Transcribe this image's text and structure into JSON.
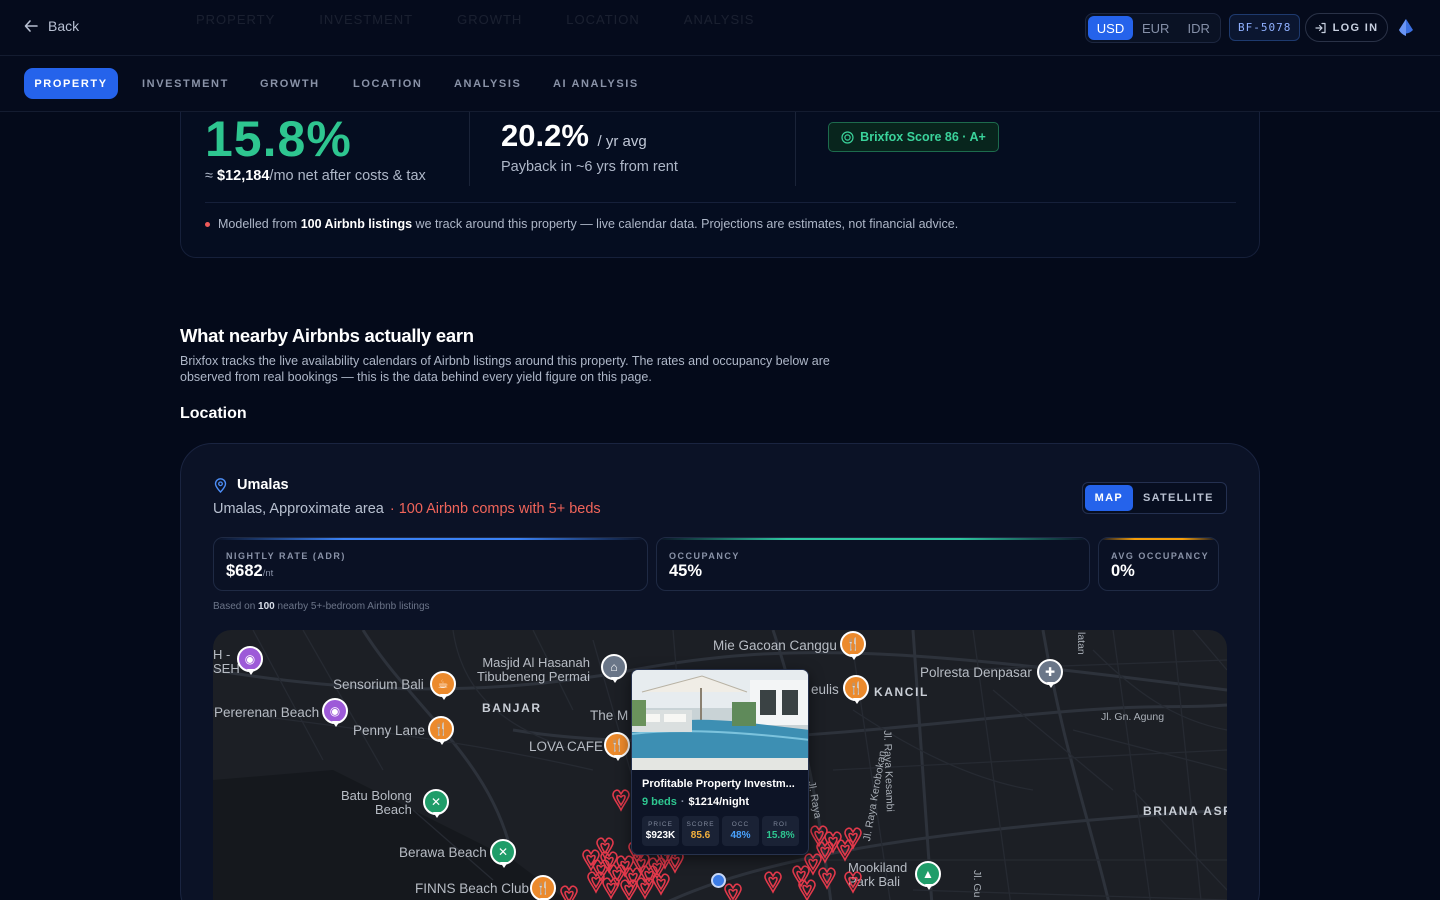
{
  "header": {
    "back_label": "Back",
    "ghost_tabs": [
      "PROPERTY",
      "INVESTMENT",
      "GROWTH",
      "LOCATION",
      "ANALYSIS"
    ],
    "currencies": [
      "USD",
      "EUR",
      "IDR"
    ],
    "active_currency": "USD",
    "property_code": "BF-5078",
    "login_label": "LOG IN"
  },
  "nav": {
    "tabs": [
      {
        "label": "PROPERTY",
        "active": true
      },
      {
        "label": "INVESTMENT",
        "active": false
      },
      {
        "label": "GROWTH",
        "active": false
      },
      {
        "label": "LOCATION",
        "active": false
      },
      {
        "label": "ANALYSIS",
        "active": false
      },
      {
        "label": "AI ANALYSIS",
        "active": false
      }
    ]
  },
  "summary": {
    "net_yield": "15.8%",
    "net_prefix": "≈",
    "net_monthly": "$12,184",
    "net_suffix": "/mo net after costs & tax",
    "roi_value": "20.2%",
    "roi_unit": "/ yr avg",
    "payback": "Payback in ~6 yrs from rent",
    "score_label": "Brixfox Score 86 · A+",
    "modelled_prefix": "Modelled from",
    "modelled_bold": "100 Airbnb listings",
    "modelled_suffix": "we track around this property — live calendar data. Projections are estimates, not financial advice."
  },
  "section": {
    "title": "What nearby Airbnbs actually earn",
    "lead": "Brixfox tracks the live availability calendars of Airbnb listings around this property. The rates and occupancy below are observed from real bookings — this is the data behind every yield figure on this page.",
    "location_heading": "Location"
  },
  "location": {
    "name": "Umalas",
    "subtitle": "Umalas, Approximate area",
    "comps": "· 100 Airbnb comps with 5+ beds",
    "view_options": [
      "MAP",
      "SATELLITE"
    ],
    "active_view": "MAP",
    "metrics": [
      {
        "label": "NIGHTLY RATE (ADR)",
        "value": "$682",
        "unit": "/nt",
        "accent": "#3b82f6"
      },
      {
        "label": "OCCUPANCY",
        "value": "45%",
        "unit": "",
        "accent": "#2ec6a0"
      },
      {
        "label": "AVG OCCUPANCY",
        "value": "0%",
        "unit": "",
        "accent": "#f59e0b"
      }
    ],
    "based_prefix": "Based on",
    "based_count": "100",
    "based_suffix": "nearby 5+-bedroom Airbnb listings"
  },
  "map": {
    "labels": {
      "mie_gacoan": "Mie Gacoan Canggu",
      "masjid": "Masjid Al Hasanah\nTibubeneng Permai",
      "sensorium": "Sensorium Bali",
      "pererenan": "Pererenan Beach",
      "penny_lane": "Penny Lane",
      "banjar": "BANJAR",
      "lova_cafe": "LOVA CAFE",
      "the_m": "The M",
      "batu_bolong": "Batu Bolong\nBeach",
      "berawa": "Berawa Beach",
      "finns": "FINNS Beach Club",
      "heulis": "eulis",
      "kancil": "KANCIL",
      "polresta": "Polresta Denpasar",
      "gn_agung": "Jl. Gn. Agung",
      "briana": "BRIANA ASRI",
      "mookiland": "Mookiland\nPark Bali",
      "raya_kesambi": "Jl. Raya Kesambi",
      "raya_kerobokan": "Jl. Raya Kerobokan",
      "raya_seminyak": "Jl. Raya",
      "jl_gu": "Jl. Gu",
      "latan": "latan",
      "hseh": "H -\nSEH"
    },
    "popup": {
      "title": "Profitable Property Investm...",
      "beds": "9 beds",
      "price_night": "$1214/night",
      "stats": [
        {
          "key": "PRICE",
          "value": "$923K",
          "color": "#ffffff"
        },
        {
          "key": "SCORE",
          "value": "85.6",
          "color": "#f5b13d"
        },
        {
          "key": "OCC",
          "value": "48%",
          "color": "#4aa3ff"
        },
        {
          "key": "ROI",
          "value": "15.8%",
          "color": "#2ec690"
        }
      ]
    }
  }
}
